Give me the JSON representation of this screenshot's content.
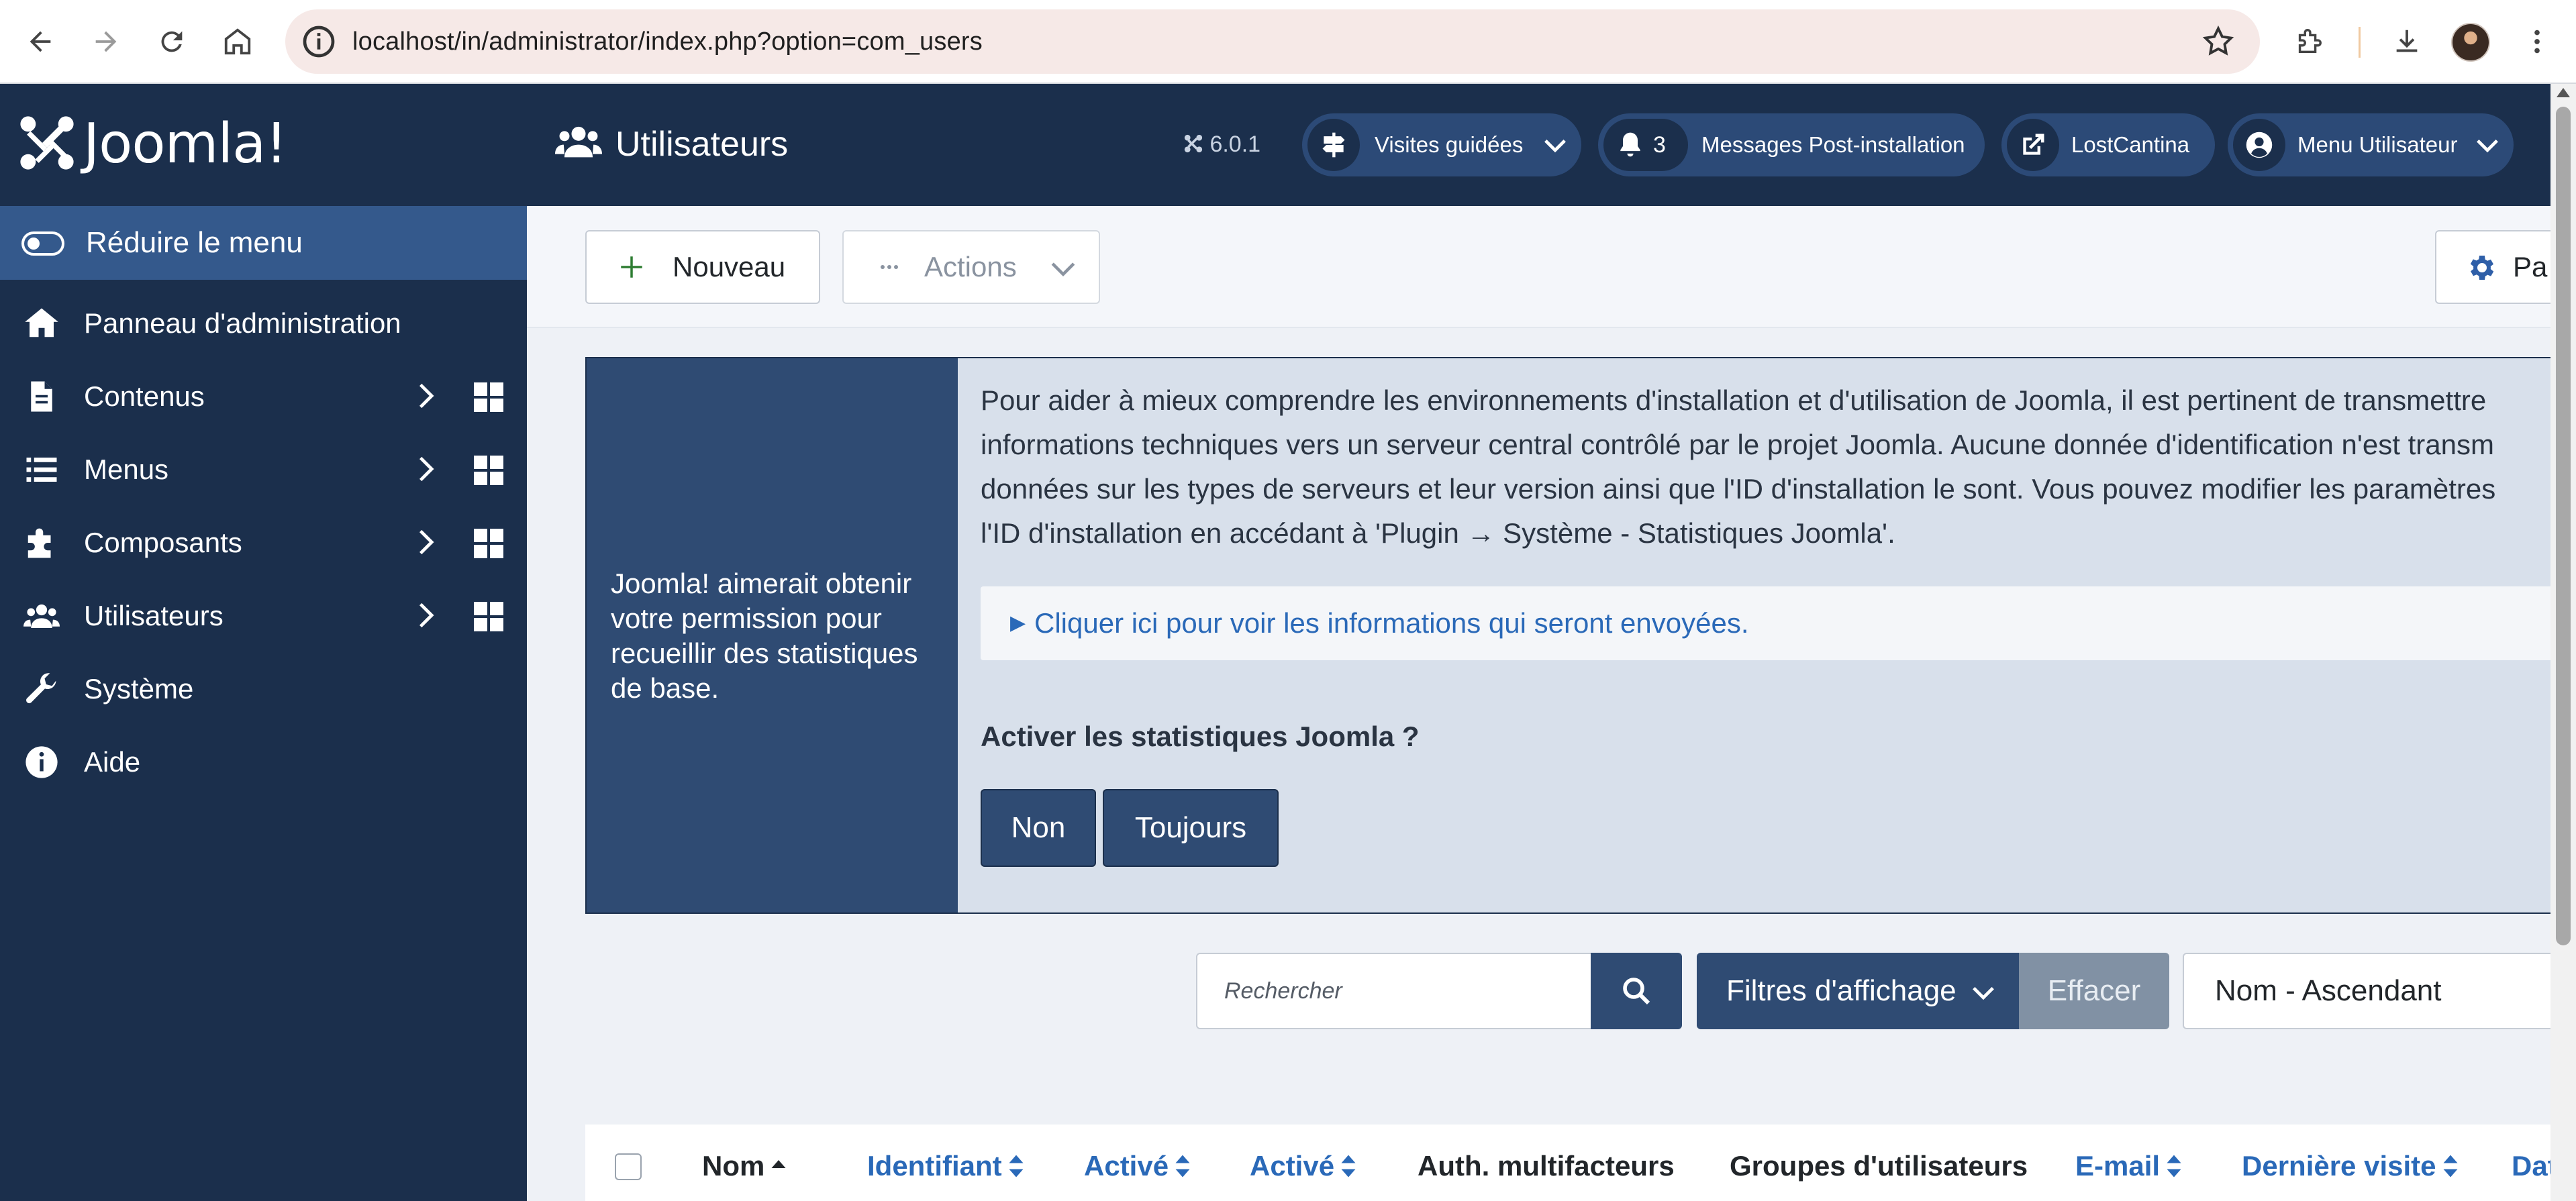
{
  "browser": {
    "url": "localhost/in/administrator/index.php?option=com_users"
  },
  "sidebar": {
    "logo_text": "Joomla!",
    "logo_mark": "®",
    "toggle_label": "Réduire le menu",
    "items": [
      {
        "label": "Panneau d'administration",
        "icon": "home-icon"
      },
      {
        "label": "Contenus",
        "icon": "file-icon"
      },
      {
        "label": "Menus",
        "icon": "list-icon"
      },
      {
        "label": "Composants",
        "icon": "puzzle-icon"
      },
      {
        "label": "Utilisateurs",
        "icon": "users-icon"
      },
      {
        "label": "Système",
        "icon": "wrench-icon"
      },
      {
        "label": "Aide",
        "icon": "info-icon"
      }
    ]
  },
  "header": {
    "title": "Utilisateurs",
    "version": "6.0.1",
    "tours_label": "Visites guidées",
    "messages_count": "3",
    "messages_label": "Messages Post-installation",
    "site_label": "LostCantina",
    "user_menu_label": "Menu Utilisateur"
  },
  "toolbar": {
    "new_label": "Nouveau",
    "actions_label": "Actions",
    "options_label": "Pa"
  },
  "stats": {
    "left_text": "Joomla! aimerait obtenir votre permission pour recueillir des statistiques de base.",
    "paragraph": "Pour aider à mieux comprendre les environnements d'installation et d'utilisation de Joomla, il est pertinent de transmettre des informations techniques vers un serveur central contrôlé par le projet Joomla. Aucune donnée d'identification n'est transmise, seules des données sur les types de serveurs et leur version ainsi que l'ID d'installation le sont. Vous pouvez modifier les paramètres et l'ID d'installation en accédant à 'Plugin → Système - Statistiques Joomla'.",
    "para_lines": [
      "Pour aider à mieux comprendre les environnements d'installation et d'utilisation de Joomla, il est pertinent de transmettre",
      "informations techniques vers un serveur central contrôlé par le projet Joomla. Aucune donnée d'identification n'est transm",
      "données sur les types de serveurs et leur version ainsi que l'ID d'installation le sont. Vous pouvez modifier les paramètres",
      "l'ID d'installation en accédant à 'Plugin → Système - Statistiques Joomla'."
    ],
    "details_caret": "▶",
    "details_label": "Cliquer ici pour voir les informations qui seront envoyées.",
    "question": "Activer les statistiques Joomla ?",
    "no_label": "Non",
    "always_label": "Toujours"
  },
  "search": {
    "placeholder": "Rechercher",
    "filter_label": "Filtres d'affichage",
    "clear_label": "Effacer",
    "sort_value": "Nom - Ascendant"
  },
  "table": {
    "columns": [
      {
        "label": "Nom",
        "sort": "asc"
      },
      {
        "label": "Identifiant",
        "sort": "both"
      },
      {
        "label": "Activé",
        "sort": "both"
      },
      {
        "label": "Activé",
        "sort": "both"
      },
      {
        "label": "Auth. multifacteurs",
        "sort": "none"
      },
      {
        "label": "Groupes d'utilisateurs",
        "sort": "none"
      },
      {
        "label": "E-mail",
        "sort": "both"
      },
      {
        "label": "Dernière visite",
        "sort": "both"
      },
      {
        "label": "Dat",
        "sort": "none"
      }
    ]
  },
  "colors": {
    "sidebar_bg": "#1b2f4c",
    "active_item": "#34598c",
    "primary_button": "#2f4b73",
    "link": "#2a69b8"
  }
}
